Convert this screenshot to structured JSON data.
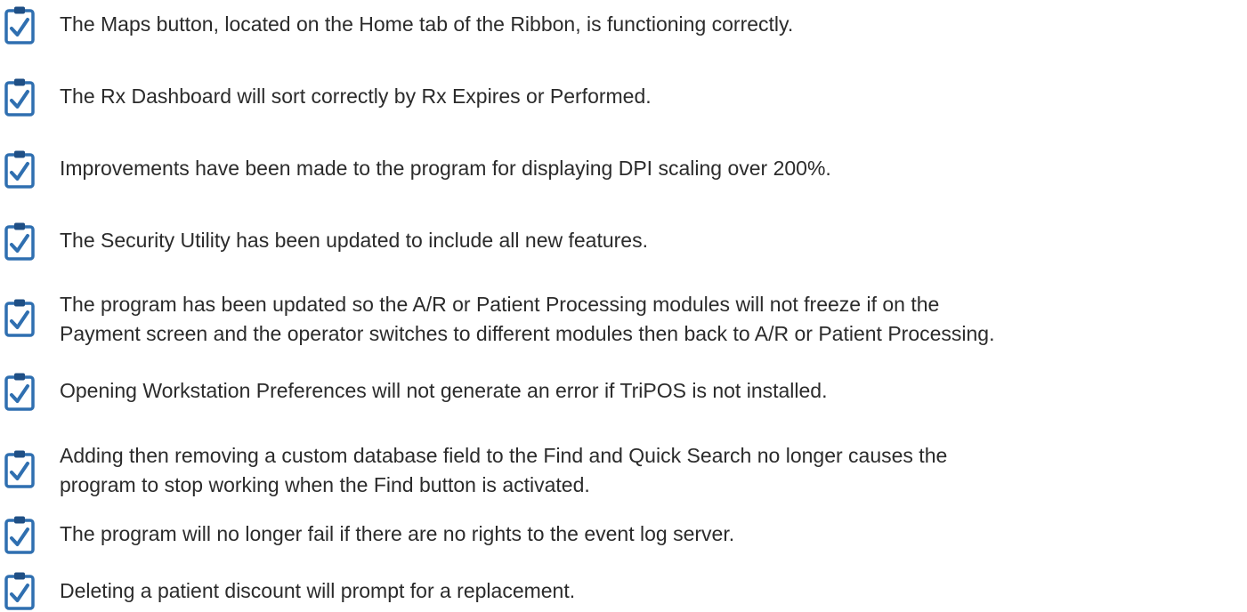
{
  "colors": {
    "text": "#2b2b2b",
    "icon_border": "#2f6fb0",
    "icon_check": "#2f6fb0",
    "icon_clip": "#1f4f85"
  },
  "items": [
    {
      "icon": "clipboard-check-icon",
      "lines": [
        "The Maps button, located on the Home tab of the Ribbon, is functioning correctly."
      ]
    },
    {
      "icon": "clipboard-check-icon",
      "lines": [
        "The Rx Dashboard will sort correctly by Rx Expires or Performed."
      ]
    },
    {
      "icon": "clipboard-check-icon",
      "lines": [
        "Improvements have been made to the program for displaying DPI scaling over 200%."
      ]
    },
    {
      "icon": "clipboard-check-icon",
      "lines": [
        "The Security Utility has been updated to include all new features."
      ]
    },
    {
      "icon": "clipboard-check-icon",
      "lines": [
        "The program has been updated so the A/R or Patient Processing modules will not freeze if on the",
        "Payment screen and the operator switches to different modules then back to A/R or Patient Processing."
      ]
    },
    {
      "icon": "clipboard-check-icon",
      "lines": [
        "Opening Workstation Preferences will not generate an error if TriPOS is not installed."
      ]
    },
    {
      "icon": "clipboard-check-icon",
      "lines": [
        "Adding then removing a custom database field to the Find and Quick Search no longer causes the",
        "program to stop working when the Find button is activated."
      ]
    },
    {
      "icon": "clipboard-check-icon",
      "lines": [
        "The program will no longer fail if there are no rights to the event log server."
      ]
    },
    {
      "icon": "clipboard-check-icon",
      "lines": [
        "Deleting a patient discount will prompt for a replacement."
      ]
    }
  ]
}
